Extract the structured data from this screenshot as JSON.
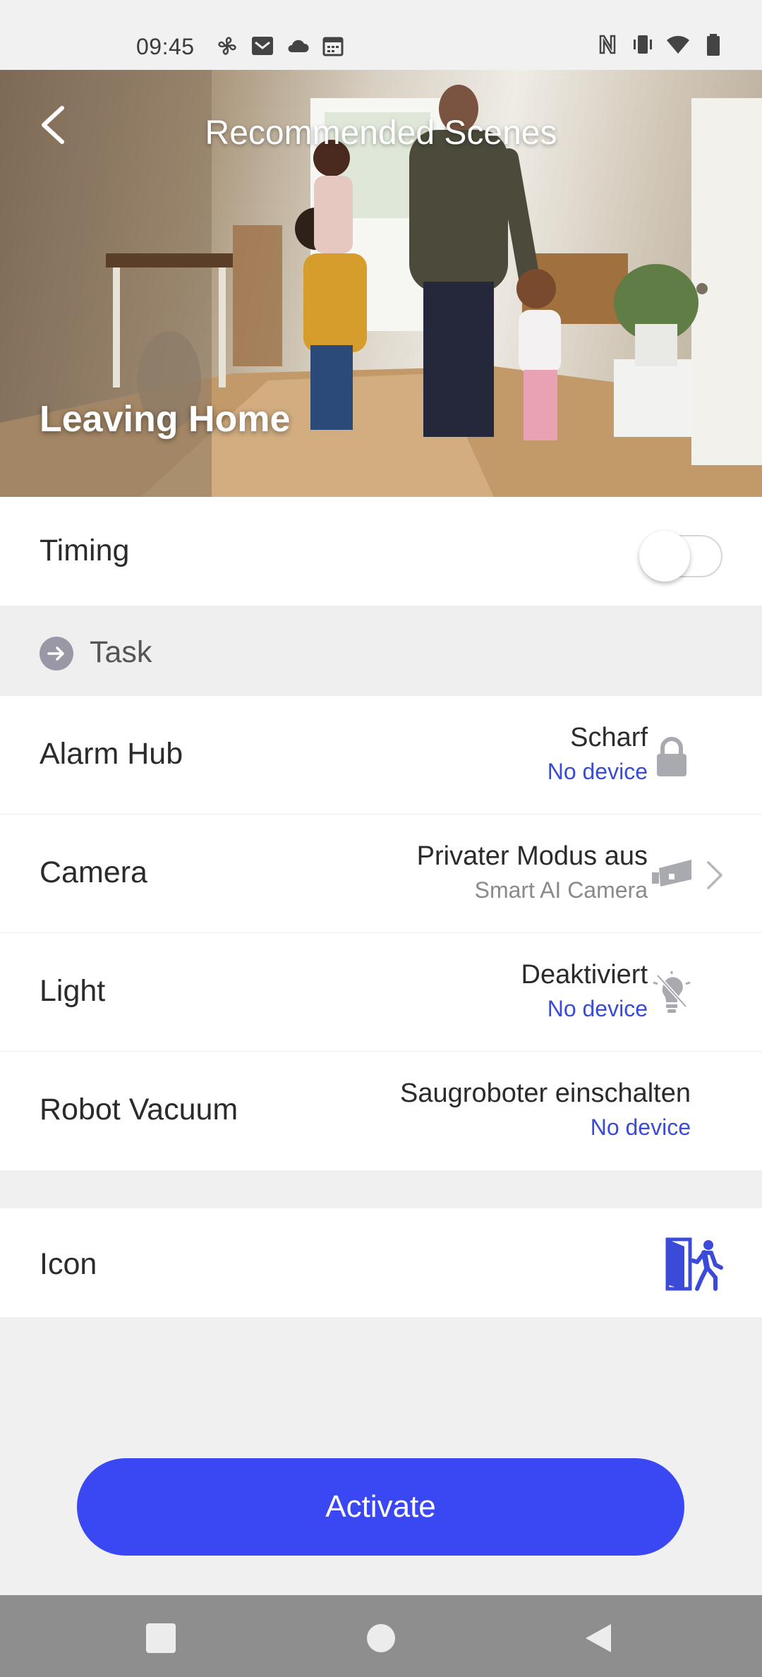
{
  "status_bar": {
    "time": "09:45"
  },
  "header": {
    "title": "Recommended Scenes",
    "scene_name": "Leaving Home"
  },
  "timing": {
    "label": "Timing",
    "enabled": false
  },
  "task_section": {
    "label": "Task"
  },
  "tasks": [
    {
      "label": "Alarm Hub",
      "value": "Scharf",
      "sub": "No device",
      "sub_style": "link",
      "icon": "lock-icon"
    },
    {
      "label": "Camera",
      "value": "Privater Modus aus",
      "sub": "Smart AI Camera",
      "sub_style": "muted",
      "icon": "camera-icon"
    },
    {
      "label": "Light",
      "value": "Deaktiviert",
      "sub": "No device",
      "sub_style": "link",
      "icon": "light-off-icon"
    },
    {
      "label": "Robot Vacuum",
      "value": "Saugroboter einschalten",
      "sub": "No device",
      "sub_style": "link",
      "icon": ""
    }
  ],
  "icon_row": {
    "label": "Icon",
    "icon": "leaving-home-icon"
  },
  "actions": {
    "activate_label": "Activate"
  },
  "colors": {
    "accent": "#3A48F4",
    "link": "#3A4BD6",
    "icon_blue": "#3B4BD8",
    "muted_icon": "#A9A9B0"
  }
}
